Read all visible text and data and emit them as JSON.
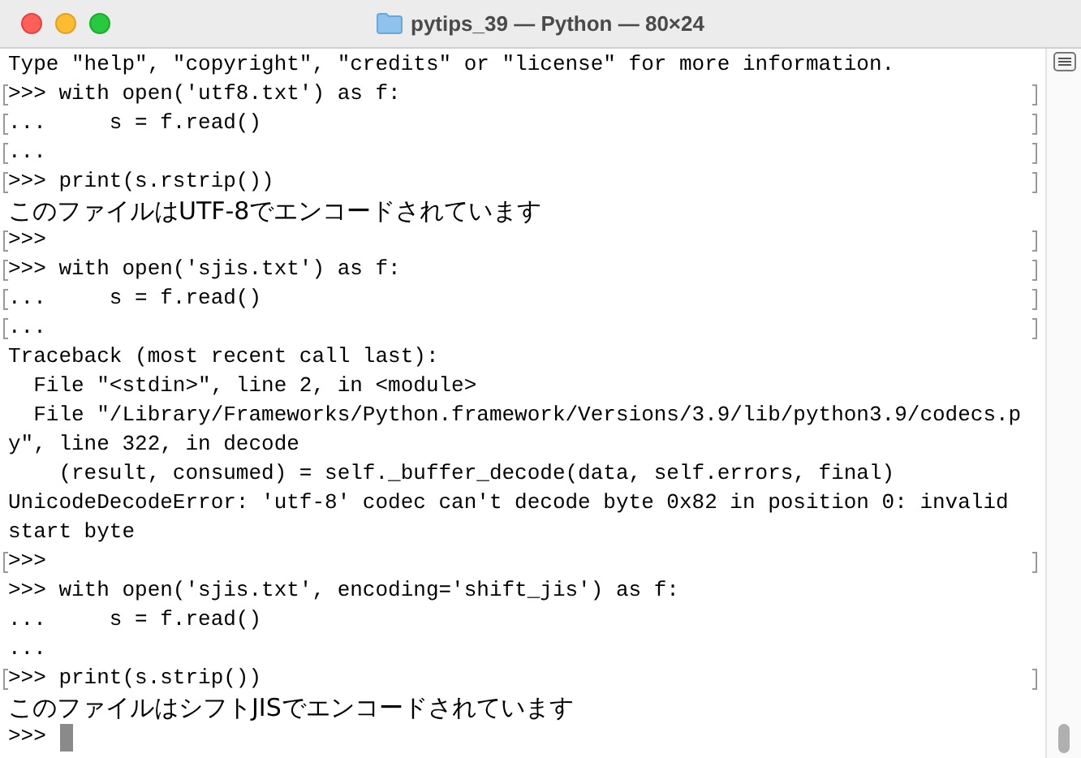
{
  "window": {
    "title": "pytips_39 — Python — 80×24"
  },
  "lines": [
    {
      "text": "Type \"help\", \"copyright\", \"credits\" or \"license\" for more information.",
      "kind": "code",
      "marked": false
    },
    {
      "text": ">>> with open('utf8.txt') as f:",
      "kind": "code",
      "marked": true
    },
    {
      "text": "...     s = f.read()",
      "kind": "code",
      "marked": true
    },
    {
      "text": "...",
      "kind": "code",
      "marked": true
    },
    {
      "text": ">>> print(s.rstrip())",
      "kind": "code",
      "marked": true
    },
    {
      "text": "このファイルはUTF-8でエンコードされています",
      "kind": "jp",
      "marked": false
    },
    {
      "text": ">>>",
      "kind": "code",
      "marked": true
    },
    {
      "text": ">>> with open('sjis.txt') as f:",
      "kind": "code",
      "marked": true
    },
    {
      "text": "...     s = f.read()",
      "kind": "code",
      "marked": true
    },
    {
      "text": "...",
      "kind": "code",
      "marked": true
    },
    {
      "text": "Traceback (most recent call last):",
      "kind": "code",
      "marked": false
    },
    {
      "text": "  File \"<stdin>\", line 2, in <module>",
      "kind": "code",
      "marked": false
    },
    {
      "text": "  File \"/Library/Frameworks/Python.framework/Versions/3.9/lib/python3.9/codecs.p",
      "kind": "code",
      "marked": false
    },
    {
      "text": "y\", line 322, in decode",
      "kind": "code",
      "marked": false
    },
    {
      "text": "    (result, consumed) = self._buffer_decode(data, self.errors, final)",
      "kind": "code",
      "marked": false
    },
    {
      "text": "UnicodeDecodeError: 'utf-8' codec can't decode byte 0x82 in position 0: invalid",
      "kind": "code",
      "marked": false
    },
    {
      "text": "start byte",
      "kind": "code",
      "marked": false
    },
    {
      "text": ">>>",
      "kind": "code",
      "marked": true
    },
    {
      "text": ">>> with open('sjis.txt', encoding='shift_jis') as f:",
      "kind": "code",
      "marked": false
    },
    {
      "text": "...     s = f.read()",
      "kind": "code",
      "marked": false
    },
    {
      "text": "...",
      "kind": "code",
      "marked": false
    },
    {
      "text": ">>> print(s.strip())",
      "kind": "code",
      "marked": true
    },
    {
      "text": "このファイルはシフトJISでエンコードされています",
      "kind": "jp",
      "marked": false
    },
    {
      "text": ">>>",
      "kind": "code",
      "marked": false,
      "cursor": true
    }
  ]
}
